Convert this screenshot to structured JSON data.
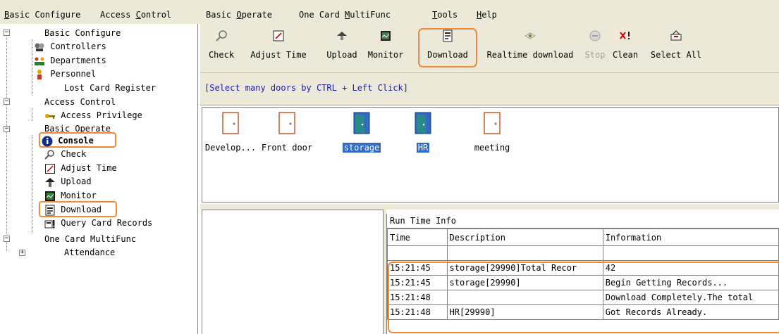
{
  "menu": [
    {
      "label": "Basic Configure",
      "underline": "B"
    },
    {
      "label": "Access Control",
      "underline": "C"
    },
    {
      "label": "Basic Operate",
      "underline": "O"
    },
    {
      "label": "One Card MultiFunc",
      "underline": "M"
    },
    {
      "label": "Tools",
      "underline": "T"
    },
    {
      "label": "Help",
      "underline": "H"
    }
  ],
  "tree": {
    "basic_configure": "Basic Configure",
    "controllers": "Controllers",
    "departments": "Departments",
    "personnel": "Personnel",
    "lost_card": "Lost Card Register",
    "access_control": "Access Control",
    "access_privilege": "Access Privilege",
    "basic_operate": "Basic Operate",
    "console": "Console",
    "check": "Check",
    "adjust_time": "Adjust Time",
    "upload": "Upload",
    "monitor": "Monitor",
    "download": "Download",
    "query_card": "Query Card Records",
    "one_card": "One Card MultiFunc",
    "attendance": "Attendance"
  },
  "toolbar": {
    "check": "Check",
    "adjust_time": "Adjust Time",
    "upload": "Upload",
    "monitor": "Monitor",
    "download": "Download",
    "realtime": "Realtime download",
    "stop": "Stop",
    "clean": "Clean",
    "select_all": "Select All"
  },
  "hint": "[Select many doors by CTRL + Left Click]",
  "doors": [
    {
      "label": "Develop...",
      "selected": false
    },
    {
      "label": "Front door",
      "selected": false
    },
    {
      "label": "storage",
      "selected": true
    },
    {
      "label": "HR",
      "selected": true
    },
    {
      "label": "meeting",
      "selected": false
    }
  ],
  "runtime": {
    "caption": "Run Time Info",
    "columns": {
      "time": "Time",
      "description": "Description",
      "information": "Information"
    },
    "rows": [
      {
        "time": "",
        "description": "",
        "information": ""
      },
      {
        "time": "15:21:45",
        "description": "storage[29990]Total Recor",
        "information": "42"
      },
      {
        "time": "15:21:45",
        "description": "storage[29990]",
        "information": "Begin Getting Records..."
      },
      {
        "time": "15:21:48",
        "description": "",
        "information": "Download Completely.The total"
      },
      {
        "time": "15:21:48",
        "description": "HR[29990]",
        "information": "Got Records Already."
      }
    ]
  },
  "colors": {
    "highlight": "#f08a3c",
    "selection": "#316ac5",
    "chrome": "#ece9d8",
    "hint_text": "#1a1aa6",
    "door": "#c85a2a",
    "door_selected": "#2a8a8a"
  }
}
